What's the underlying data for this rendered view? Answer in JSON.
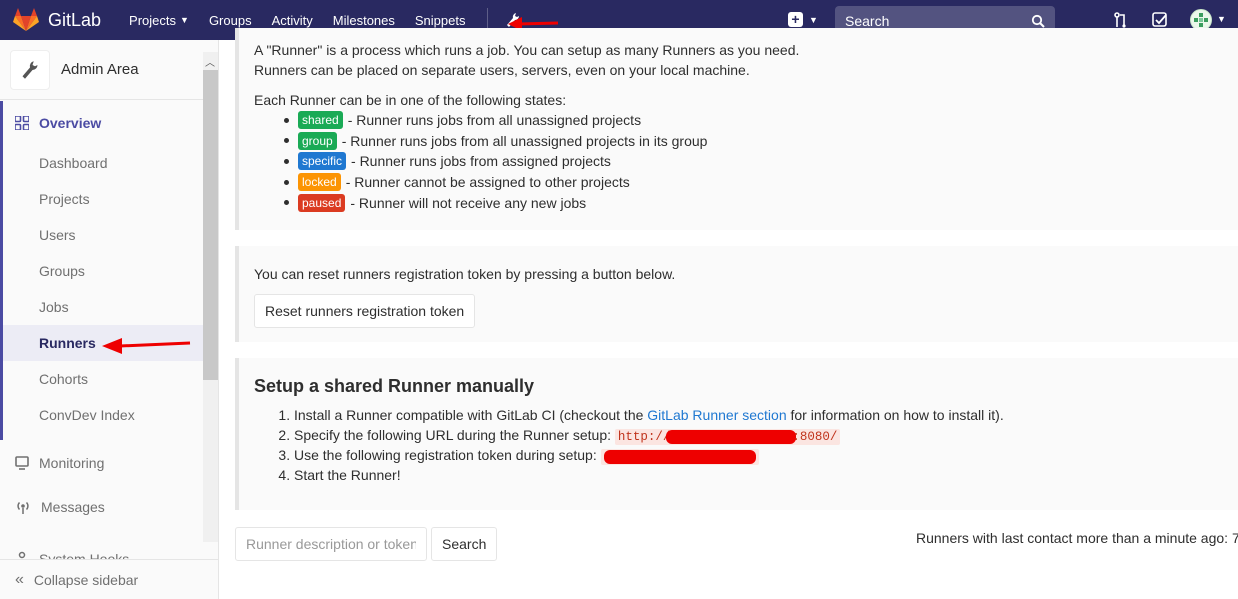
{
  "brand": {
    "name": "GitLab"
  },
  "topnav": {
    "links": [
      {
        "label": "Projects",
        "has_caret": true
      },
      {
        "label": "Groups"
      },
      {
        "label": "Activity"
      },
      {
        "label": "Milestones"
      },
      {
        "label": "Snippets"
      }
    ],
    "search_placeholder": "Search",
    "icons": [
      "gitlab-logo-icon",
      "wrench-icon",
      "plus-square-icon",
      "chevron-down-icon",
      "search-icon",
      "merge-request-icon",
      "todo-check-icon",
      "user-avatar-icon"
    ],
    "bg_color": "#292961"
  },
  "sidebar": {
    "title": "Admin Area",
    "overview_label": "Overview",
    "items": [
      {
        "label": "Dashboard"
      },
      {
        "label": "Projects"
      },
      {
        "label": "Users"
      },
      {
        "label": "Groups"
      },
      {
        "label": "Jobs"
      },
      {
        "label": "Runners",
        "active": true
      },
      {
        "label": "Cohorts"
      },
      {
        "label": "ConvDev Index"
      }
    ],
    "monitoring_label": "Monitoring",
    "messages_label": "Messages",
    "system_hooks_label": "System Hooks",
    "collapse_label": "Collapse sidebar",
    "accent_color": "#4b4ba3"
  },
  "main": {
    "intro_line1": "A \"Runner\" is a process which runs a job. You can setup as many Runners as you need.",
    "intro_line2": "Runners can be placed on separate users, servers, even on your local machine.",
    "states_intro": "Each Runner can be in one of the following states:",
    "states": [
      {
        "badge": "shared",
        "color": "#1aaa55",
        "text": "- Runner runs jobs from all unassigned projects"
      },
      {
        "badge": "group",
        "color": "#1aaa55",
        "text": "- Runner runs jobs from all unassigned projects in its group"
      },
      {
        "badge": "specific",
        "color": "#1f78d1",
        "text": "- Runner runs jobs from assigned projects"
      },
      {
        "badge": "locked",
        "color": "#fc9403",
        "text": "- Runner cannot be assigned to other projects"
      },
      {
        "badge": "paused",
        "color": "#db3b21",
        "text": "- Runner will not receive any new jobs"
      }
    ],
    "reset_text": "You can reset runners registration token by pressing a button below.",
    "reset_button": "Reset runners registration token",
    "setup_title": "Setup a shared Runner manually",
    "step1_pre": "Install a Runner compatible with GitLab CI (checkout the ",
    "step1_link": "GitLab Runner section",
    "step1_post": " for information on how to install it).",
    "step2_pre": "Specify the following URL during the Runner setup:",
    "step2_url_start": "http://",
    "step2_url_end": ":8080/",
    "step3_pre": "Use the following registration token during setup:",
    "step4": "Start the Runner!",
    "filter_placeholder": "Runner description or token",
    "filter_button": "Search",
    "contact_text": "Runners with last contact more than a minute ago: 7"
  }
}
